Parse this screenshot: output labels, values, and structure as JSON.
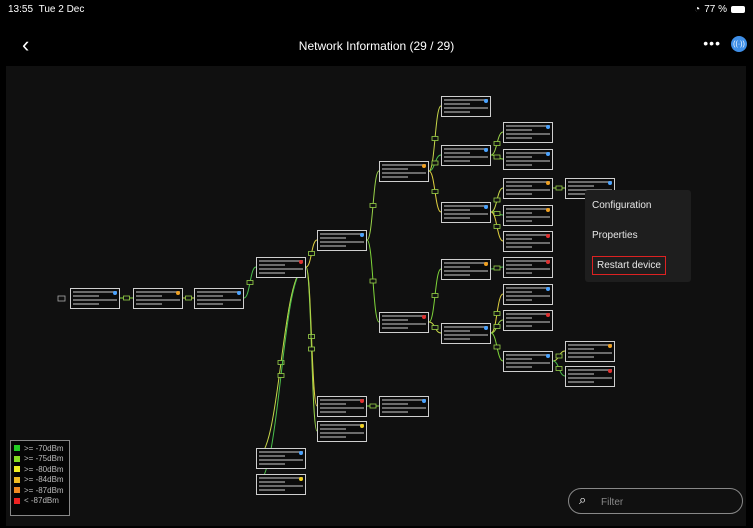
{
  "status_bar": {
    "time": "13:55",
    "date": "Tue 2 Dec",
    "battery": "77 %"
  },
  "nav": {
    "back_icon": "chevron-left-icon",
    "title": "Network Information (29 / 29)",
    "more_icon": "ellipsis-icon",
    "bluetooth_icon": "bluetooth-broadcast-icon"
  },
  "context_menu": {
    "items": [
      {
        "label": "Configuration"
      },
      {
        "label": "Properties"
      },
      {
        "label": "Restart device",
        "highlighted": true
      }
    ]
  },
  "legend": {
    "items": [
      {
        "label": ">= -70dBm",
        "color": "#22cc22"
      },
      {
        "label": ">= -75dBm",
        "color": "#88dd22"
      },
      {
        "label": ">= -80dBm",
        "color": "#eeee22"
      },
      {
        "label": ">= -84dBm",
        "color": "#eebb22"
      },
      {
        "label": ">= -87dBm",
        "color": "#ee8822"
      },
      {
        "label": "< -87dBm",
        "color": "#ee2222"
      }
    ]
  },
  "filter": {
    "placeholder": "Filter",
    "search_icon": "search-icon"
  },
  "node_status_colors": {
    "blue": "#4aa3ff",
    "orange": "#f0a020",
    "red": "#e03030",
    "yellow": "#f0d020"
  }
}
